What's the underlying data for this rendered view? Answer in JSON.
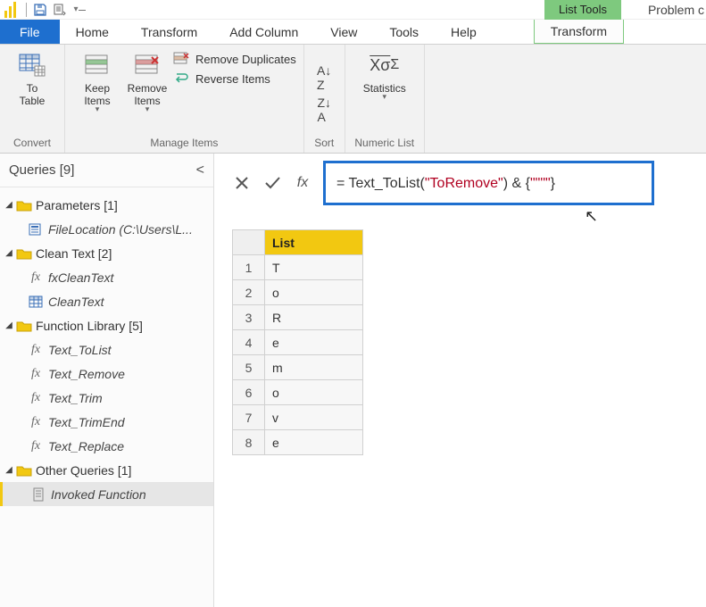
{
  "titlebar": {
    "context_tab": "List Tools",
    "window_title": "Problem c"
  },
  "menu": {
    "file": "File",
    "tabs": [
      "Home",
      "Transform",
      "Add Column",
      "View",
      "Tools",
      "Help"
    ],
    "ctx_tab": "Transform"
  },
  "ribbon": {
    "convert": {
      "to_table": "To\nTable",
      "label": "Convert"
    },
    "manage": {
      "keep": "Keep\nItems",
      "remove": "Remove\nItems",
      "remove_dup": "Remove Duplicates",
      "reverse": "Reverse Items",
      "label": "Manage Items"
    },
    "sort": {
      "label": "Sort"
    },
    "numeric": {
      "stats": "Statistics",
      "label": "Numeric List"
    }
  },
  "queries": {
    "title": "Queries [9]",
    "groups": [
      {
        "name": "Parameters [1]",
        "items": [
          {
            "icon": "param",
            "label": "FileLocation (C:\\Users\\L..."
          }
        ]
      },
      {
        "name": "Clean Text [2]",
        "items": [
          {
            "icon": "fx",
            "label": "fxCleanText"
          },
          {
            "icon": "table",
            "label": "CleanText"
          }
        ]
      },
      {
        "name": "Function Library [5]",
        "items": [
          {
            "icon": "fx",
            "label": "Text_ToList"
          },
          {
            "icon": "fx",
            "label": "Text_Remove"
          },
          {
            "icon": "fx",
            "label": "Text_Trim"
          },
          {
            "icon": "fx",
            "label": "Text_TrimEnd"
          },
          {
            "icon": "fx",
            "label": "Text_Replace"
          }
        ]
      },
      {
        "name": "Other Queries [1]",
        "items": [
          {
            "icon": "list",
            "label": "Invoked Function",
            "selected": true
          }
        ]
      }
    ]
  },
  "formula": {
    "prefix": "= Text_ToList(",
    "string": "\"ToRemove\"",
    "mid": ") & {",
    "string2": "\"\"\"\"",
    "suffix": "}"
  },
  "grid": {
    "header": "List",
    "rows": [
      "T",
      "o",
      "R",
      "e",
      "m",
      "o",
      "v",
      "e"
    ]
  },
  "chart_data": {
    "type": "table",
    "title": "List",
    "categories": [
      1,
      2,
      3,
      4,
      5,
      6,
      7,
      8
    ],
    "values": [
      "T",
      "o",
      "R",
      "e",
      "m",
      "o",
      "v",
      "e"
    ]
  }
}
